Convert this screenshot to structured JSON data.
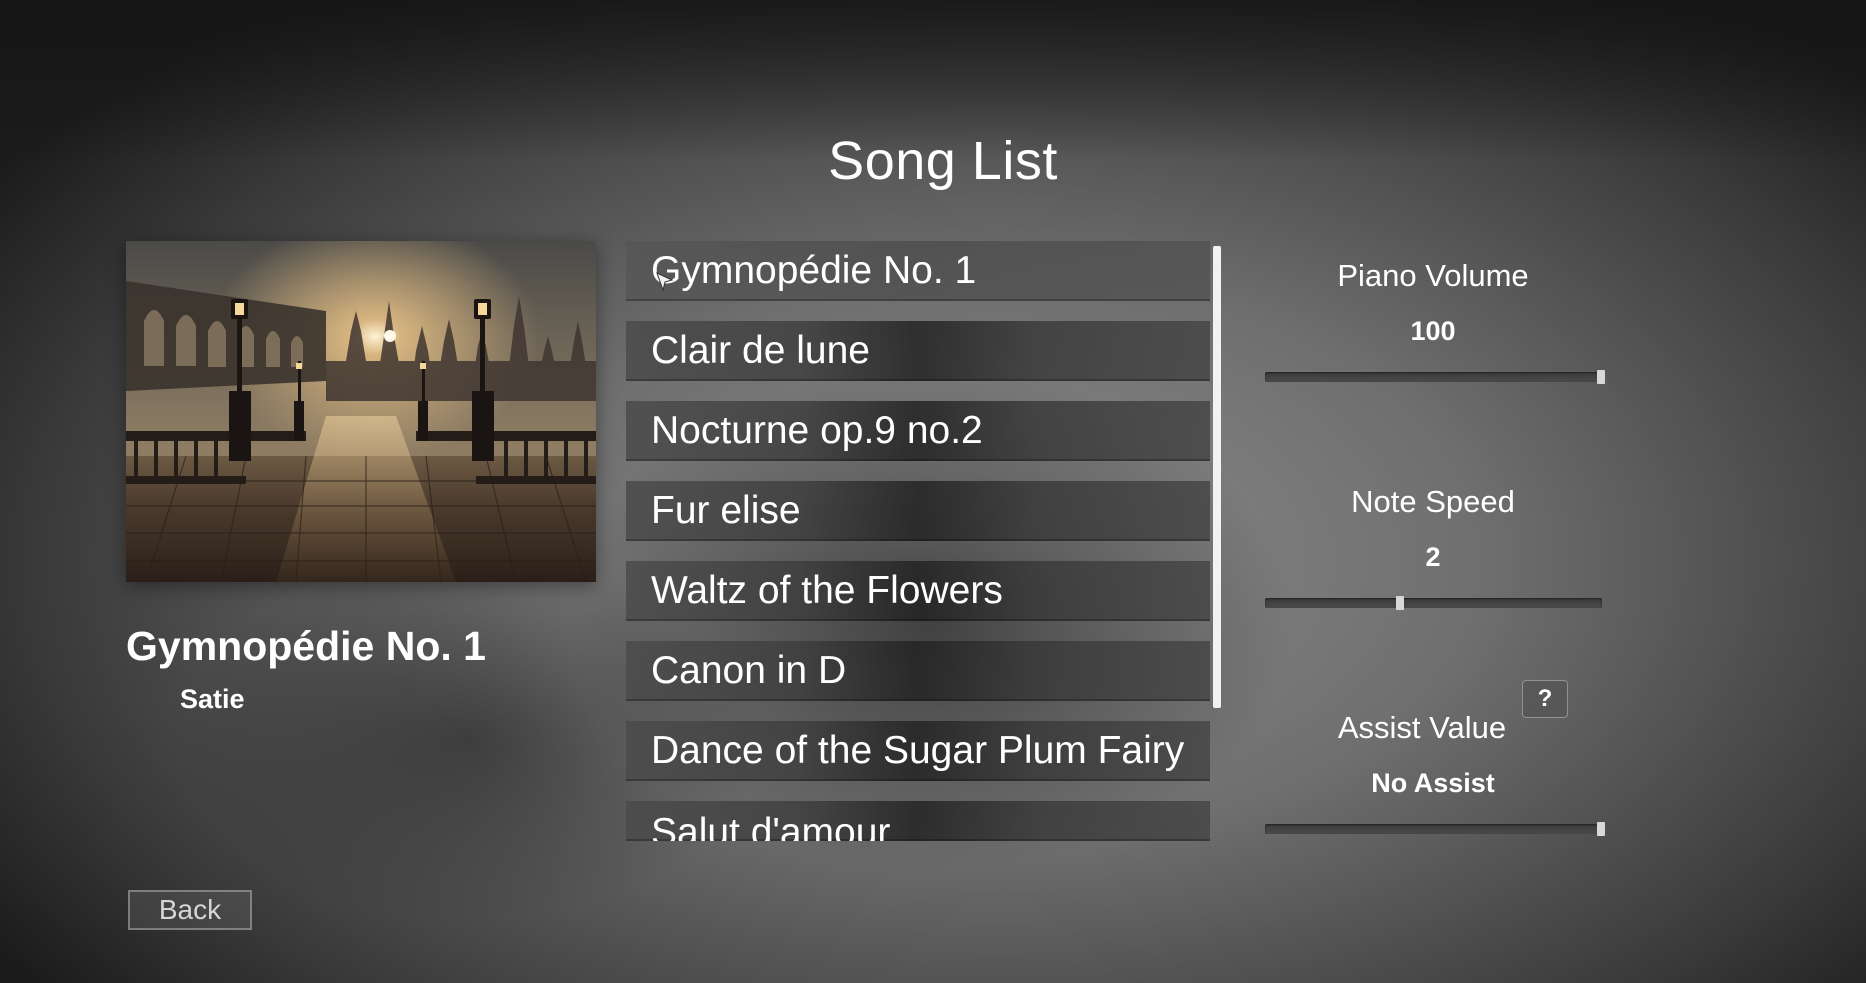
{
  "header": {
    "title": "Song List"
  },
  "selected_song": {
    "title": "Gymnopédie No. 1",
    "composer": "Satie"
  },
  "songs": [
    {
      "title": "Gymnopédie No. 1",
      "selected": true
    },
    {
      "title": "Clair de lune"
    },
    {
      "title": "Nocturne op.9 no.2"
    },
    {
      "title": "Fur elise"
    },
    {
      "title": "Waltz of the Flowers"
    },
    {
      "title": "Canon in D"
    },
    {
      "title": "Dance of the Sugar Plum Fairy"
    },
    {
      "title": "Salut d'amour"
    }
  ],
  "settings": {
    "piano_volume": {
      "label": "Piano Volume",
      "value": "100",
      "level": 1.0
    },
    "note_speed": {
      "label": "Note Speed",
      "value": "2",
      "level": 0.4
    },
    "assist_value": {
      "label": "Assist Value",
      "value": "No Assist",
      "level": 1.0,
      "help_label": "?"
    }
  },
  "footer": {
    "back_label": "Back"
  },
  "icons": {
    "cursor": "mouse-pointer-icon",
    "cover": "song-cover-art"
  }
}
